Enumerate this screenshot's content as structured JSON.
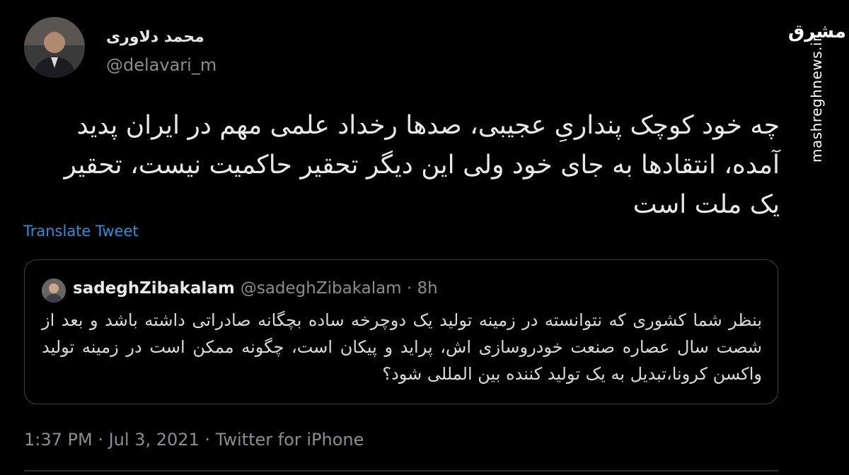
{
  "author": {
    "name": "محمد دلاوری",
    "handle": "@delavari_m"
  },
  "tweet": {
    "text": "چه خود کوچک پنداریِ عجیبی، صدها رخداد علمی مهم در ایران پدید آمده، انتقادها به جای خود ولی این دیگر تحقیر حاکمیت نیست، تحقیر یک ملت است",
    "translate_label": "Translate Tweet",
    "timestamp": "1:37 PM · Jul 3, 2021 · Twitter for iPhone"
  },
  "quote": {
    "name": "sadeghZibakalam",
    "meta": "@sadeghZibakalam · 8h",
    "text": "بنظر شما کشوری که نتوانسته در زمینه تولید یک دوچرخه ساده بچگانه صادراتی داشته باشد و بعد از شصت سال عصاره صنعت خودروسازی اش، پراید و پیکان است، چگونه ممکن است در زمینه تولید واکسن کرونا،تبدیل به یک تولید کننده بین المللی شود؟"
  },
  "watermark": {
    "logo": "مشرق",
    "url": "mashreghnews.ir"
  },
  "colors": {
    "background": "#000000",
    "link": "#2f8fd8",
    "muted": "#8a8d91"
  }
}
